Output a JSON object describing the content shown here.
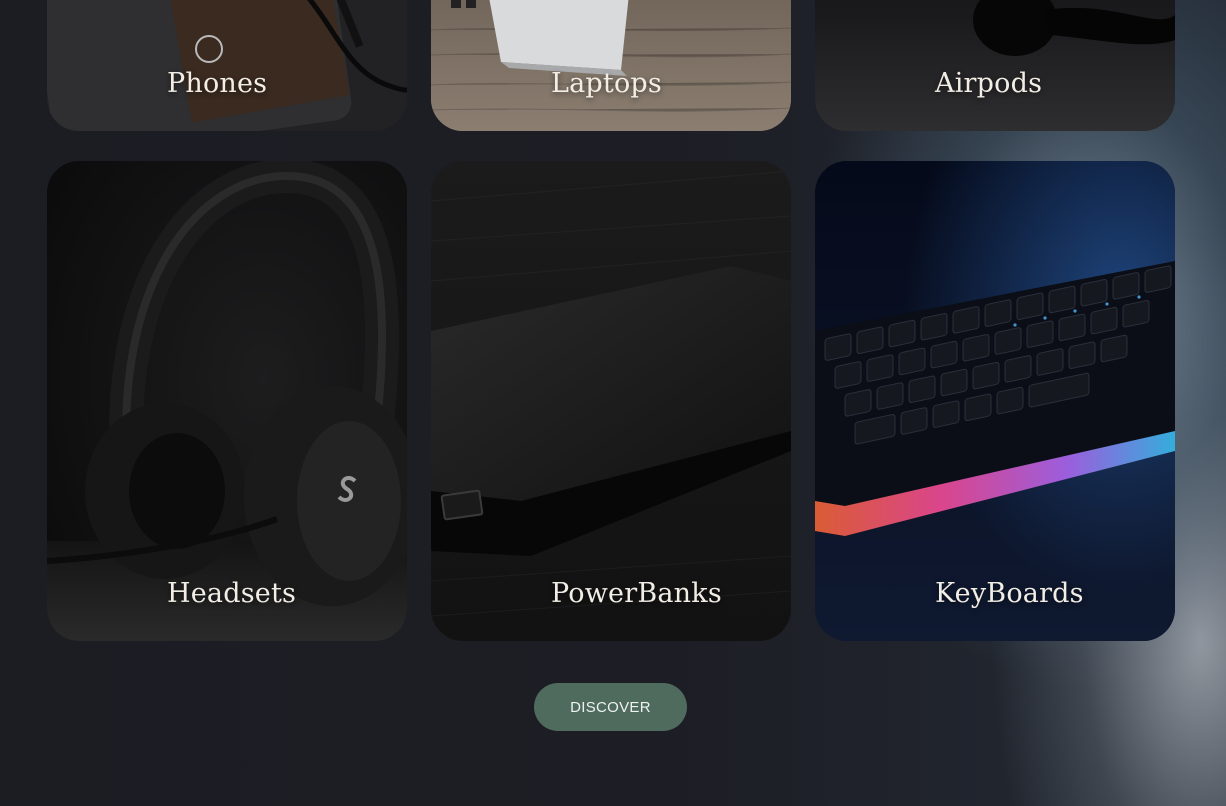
{
  "categories": [
    {
      "label": "Phones"
    },
    {
      "label": "Laptops"
    },
    {
      "label": "Airpods"
    },
    {
      "label": "Headsets"
    },
    {
      "label": "PowerBanks"
    },
    {
      "label": "KeyBoards"
    }
  ],
  "discover_label": "DISCOVER",
  "colors": {
    "button": "#4f6b5d",
    "label_text": "#f2eee6",
    "background": "#1d1e25"
  }
}
